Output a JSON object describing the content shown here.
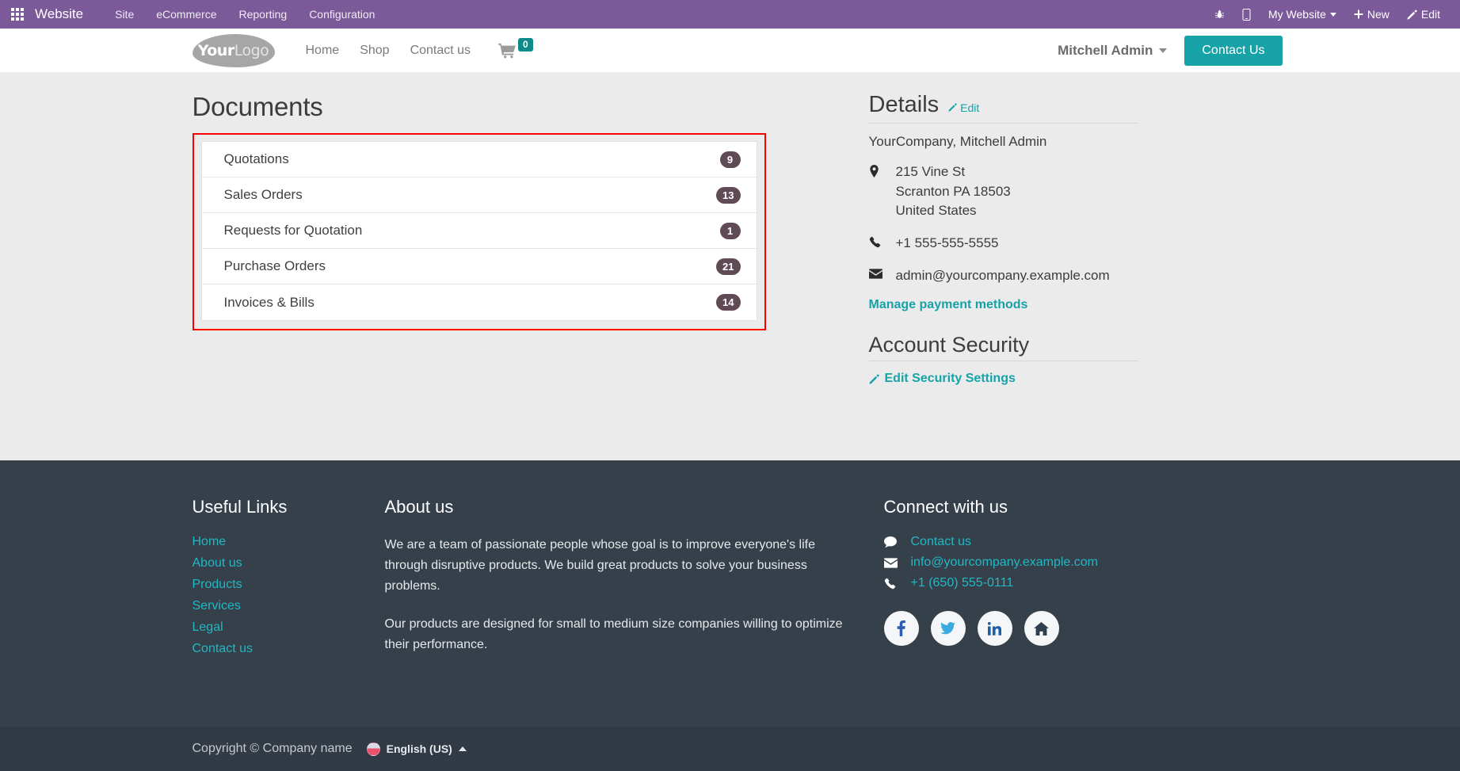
{
  "odoo_bar": {
    "apps_icon": "apps-grid-icon",
    "brand": "Website",
    "menu": [
      "Site",
      "eCommerce",
      "Reporting",
      "Configuration"
    ],
    "right": {
      "debug_icon": "bug-icon",
      "mobile_icon": "mobile-preview-icon",
      "website_selector": "My Website",
      "new_label": "New",
      "new_icon": "plus-icon",
      "edit_label": "Edit",
      "edit_icon": "pencil-icon"
    },
    "background": "#7c5a99"
  },
  "site_header": {
    "logo_primary": "Your",
    "logo_secondary": "Logo",
    "nav": [
      "Home",
      "Shop",
      "Contact us"
    ],
    "cart_icon": "shopping-cart-icon",
    "cart_count": "0",
    "user_name": "Mitchell Admin",
    "contact_button": "Contact Us",
    "accent": "#17a2a8"
  },
  "documents": {
    "title": "Documents",
    "rows": [
      {
        "label": "Quotations",
        "count": "9"
      },
      {
        "label": "Sales Orders",
        "count": "13"
      },
      {
        "label": "Requests for Quotation",
        "count": "1"
      },
      {
        "label": "Purchase Orders",
        "count": "21"
      },
      {
        "label": "Invoices & Bills",
        "count": "14"
      }
    ],
    "badge_color": "#5f4a55",
    "highlight_color": "#ff0000"
  },
  "details": {
    "title": "Details",
    "edit_label": "Edit",
    "edit_icon": "pencil-icon",
    "company": "YourCompany, Mitchell Admin",
    "address_icon": "map-pin-icon",
    "address_line1": "215 Vine St",
    "address_line2": "Scranton PA 18503",
    "address_line3": "United States",
    "phone_icon": "phone-icon",
    "phone": "+1 555-555-5555",
    "email_icon": "envelope-icon",
    "email": "admin@yourcompany.example.com",
    "payment_link": "Manage payment methods",
    "security_title": "Account Security",
    "security_link": "Edit Security Settings",
    "security_link_icon": "pencil-icon"
  },
  "footer": {
    "useful_links": {
      "title": "Useful Links",
      "links": [
        "Home",
        "About us",
        "Products",
        "Services",
        "Legal",
        "Contact us"
      ]
    },
    "about": {
      "title": "About us",
      "paragraph1": "We are a team of passionate people whose goal is to improve everyone's life through disruptive products. We build great products to solve your business problems.",
      "paragraph2": "Our products are designed for small to medium size companies willing to optimize their performance."
    },
    "connect": {
      "title": "Connect with us",
      "contact_icon": "comment-icon",
      "contact_label": "Contact us",
      "email_icon": "envelope-icon",
      "email": "info@yourcompany.example.com",
      "phone_icon": "phone-icon",
      "phone": "+1 (650) 555-0111",
      "socials": [
        "facebook-icon",
        "twitter-icon",
        "linkedin-icon",
        "home-icon"
      ]
    },
    "copyright": "Copyright © Company name",
    "language": "English (US)",
    "language_flag": "us-flag-icon",
    "background": "#36404a"
  }
}
